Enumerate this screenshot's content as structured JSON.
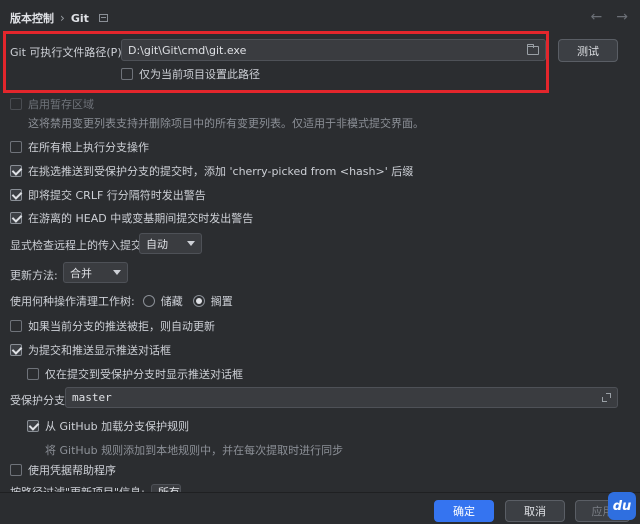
{
  "header": {
    "breadcrumb_root": "版本控制",
    "breadcrumb_sep": "›",
    "breadcrumb_current": "Git",
    "back_arrow": "←",
    "forward_arrow": "→"
  },
  "git_path": {
    "label": "Git 可执行文件路径(P):",
    "value": "D:\\git\\Git\\cmd\\git.exe",
    "test_button": "测试",
    "project_only_label": "仅为当前项目设置此路径",
    "project_only_checked": false
  },
  "staging": {
    "label": "启用暂存区域",
    "checked": false,
    "disabled": true,
    "hint": "这将禁用变更列表支持并删除项目中的所有变更列表。仅适用于非模式提交界面。"
  },
  "options": {
    "exec_branch_ops_label": "在所有根上执行分支操作",
    "exec_branch_ops_checked": false,
    "cherry_pick_label": "在挑选推送到受保护分支的提交时，添加 'cherry-picked from <hash>' 后缀",
    "cherry_pick_checked": true,
    "crlf_label": "即将提交 CRLF 行分隔符时发出警告",
    "crlf_checked": true,
    "detached_head_label": "在游离的 HEAD 中或变基期间提交时发出警告",
    "detached_head_checked": true
  },
  "incoming": {
    "label": "显式检查远程上的传入提交:",
    "selected": "自动"
  },
  "update": {
    "label": "更新方法:",
    "selected": "合并"
  },
  "clean_tree": {
    "label": "使用何种操作清理工作树:",
    "opt_stash": "储藏",
    "opt_shelve": "搁置",
    "selected": "搁置"
  },
  "push": {
    "auto_update_label": "如果当前分支的推送被拒，则自动更新",
    "auto_update_checked": false,
    "show_dialog_label": "为提交和推送显示推送对话框",
    "show_dialog_checked": true,
    "protected_only_label": "仅在提交到受保护分支时显示推送对话框",
    "protected_only_checked": false
  },
  "protected": {
    "label": "受保护分支:",
    "value": "master",
    "github_rules_label": "从 GitHub 加载分支保护规则",
    "github_rules_checked": true,
    "github_rules_hint": "将 GitHub 规则添加到本地规则中，并在每次提取时进行同步"
  },
  "credential_helper": {
    "label": "使用凭据帮助程序",
    "checked": false
  },
  "partial_row": {
    "label": "按路径过滤\"更新项目\"信息:",
    "selected": "所有"
  },
  "footer": {
    "ok": "确定",
    "cancel": "取消",
    "apply": "应用"
  },
  "watermark": "du",
  "colors": {
    "background": "#2b2d30",
    "accent": "#3574f0",
    "highlight": "#e3262c"
  }
}
